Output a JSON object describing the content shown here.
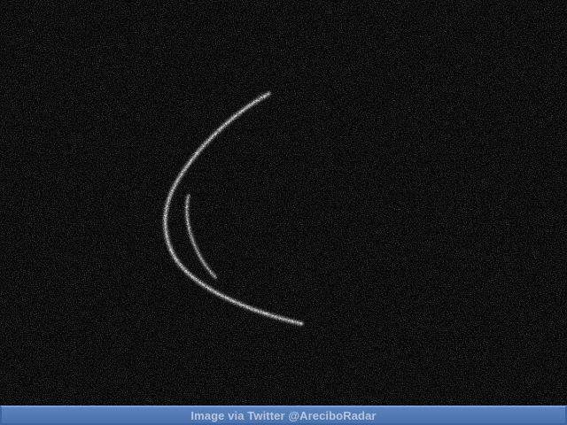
{
  "image": {
    "subject": "radar-echo"
  },
  "credit": {
    "text": "Image via Twitter @AreciboRadar"
  },
  "colors": {
    "background": "#050505",
    "echo": "#d8d8d8",
    "credit_bar": "#4f78b5",
    "credit_text": "#b9c6da"
  }
}
